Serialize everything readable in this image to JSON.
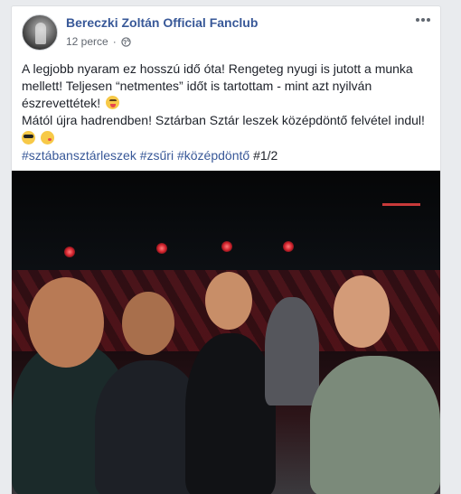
{
  "post": {
    "page_name": "Bereczki Zoltán Official Fanclub",
    "timestamp": "12 perce",
    "privacy_icon": "globe-icon",
    "more_icon": "more-options-icon",
    "text": {
      "line1": "A legjobb nyaram ez hosszú idő óta! Rengeteg nyugi is jutott a munka mellett! Teljesen “netmentes” időt is tartottam - mint azt nyilván észrevettétek!",
      "line2": "Mától újra hadrendben! Sztárban Sztár leszek középdöntő felvétel indul!"
    },
    "emojis": {
      "after_line1": "face-with-tongue-emoji",
      "after_line2": [
        "sunglasses-emoji",
        "kissing-face-emoji"
      ]
    },
    "hashtags": [
      "#sztábansztárleszek",
      "#zsűri",
      "#középdöntő"
    ],
    "counter": "#1/2",
    "photo_icon": "group-selfie-photo"
  },
  "colors": {
    "link": "#385898",
    "text": "#1d2129",
    "meta": "#616770",
    "background": "#e9ebee"
  }
}
